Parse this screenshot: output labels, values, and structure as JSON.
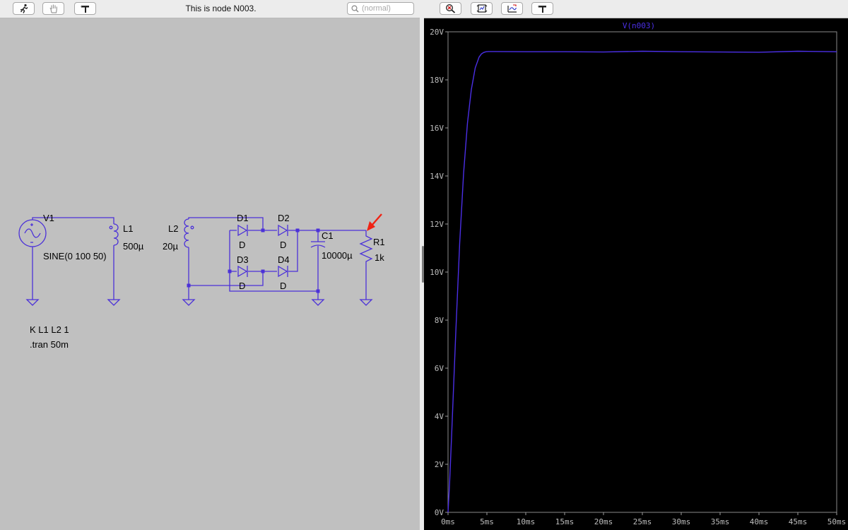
{
  "schematic_toolbar": {
    "buttons": [
      {
        "icon": "run-icon"
      },
      {
        "icon": "hand-icon"
      },
      {
        "icon": "hammer-icon"
      }
    ],
    "status_text": "This is node N003.",
    "search_placeholder": "(normal)"
  },
  "schematic": {
    "components": {
      "v1": {
        "name": "V1",
        "value": "SINE(0 100 50)"
      },
      "l1": {
        "name": "L1",
        "value": "500µ"
      },
      "l2": {
        "name": "L2",
        "value": "20µ"
      },
      "d1": {
        "name": "D1",
        "value": "D"
      },
      "d2": {
        "name": "D2",
        "value": "D"
      },
      "d3": {
        "name": "D3",
        "value": "D"
      },
      "d4": {
        "name": "D4",
        "value": "D"
      },
      "c1": {
        "name": "C1",
        "value": "10000µ"
      },
      "r1": {
        "name": "R1",
        "value": "1k"
      }
    },
    "directives": [
      "K L1 L2 1",
      ".tran 50m"
    ],
    "wire_color": "#4b31d8",
    "probe_color": "#f02314"
  },
  "plot_toolbar": {
    "buttons": [
      {
        "icon": "zoom-probe-icon"
      },
      {
        "icon": "autorange-icon"
      },
      {
        "icon": "zoom-back-icon"
      },
      {
        "icon": "hammer-icon"
      }
    ]
  },
  "chart_data": {
    "type": "line",
    "title": "V(n003)",
    "xlabel": "",
    "ylabel": "",
    "x_unit": "ms",
    "y_unit": "V",
    "xlim": [
      0,
      50
    ],
    "ylim": [
      0,
      20
    ],
    "x_ticks": [
      0,
      5,
      10,
      15,
      20,
      25,
      30,
      35,
      40,
      45,
      50
    ],
    "y_ticks": [
      0,
      2,
      4,
      6,
      8,
      10,
      12,
      14,
      16,
      18,
      20
    ],
    "x_tick_labels": [
      "0ms",
      "5ms",
      "10ms",
      "15ms",
      "20ms",
      "25ms",
      "30ms",
      "35ms",
      "40ms",
      "45ms",
      "50ms"
    ],
    "y_tick_labels": [
      "0V",
      "2V",
      "4V",
      "6V",
      "8V",
      "10V",
      "12V",
      "14V",
      "16V",
      "18V",
      "20V"
    ],
    "grid": false,
    "background": "#000000",
    "series": [
      {
        "name": "V(n003)",
        "color": "#4b2fe6",
        "x": [
          0,
          0.2,
          0.5,
          1.0,
          1.5,
          2.0,
          2.5,
          3.0,
          3.5,
          4.0,
          4.3,
          4.6,
          4.9,
          5.2,
          6,
          10,
          15,
          20,
          25,
          30,
          35,
          40,
          45,
          50
        ],
        "y": [
          0,
          1.2,
          3.5,
          7.5,
          11.2,
          14.1,
          16.2,
          17.6,
          18.5,
          18.95,
          19.08,
          19.14,
          19.17,
          19.18,
          19.18,
          19.17,
          19.17,
          19.16,
          19.19,
          19.17,
          19.16,
          19.15,
          19.19,
          19.17
        ]
      }
    ]
  }
}
